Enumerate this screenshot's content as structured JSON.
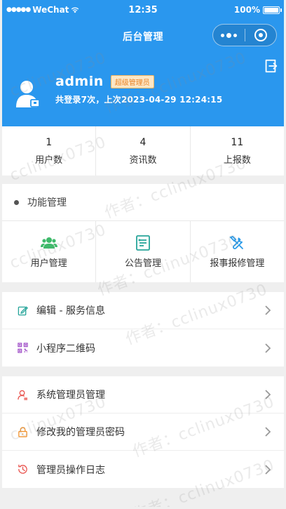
{
  "status_bar": {
    "carrier": "WeChat",
    "time": "12:35",
    "battery": "100%"
  },
  "nav": {
    "title": "后台管理"
  },
  "profile": {
    "username": "admin",
    "role": "超级管理员",
    "login_info": "共登录7次，上次2023-04-29 12:24:15"
  },
  "stats": [
    {
      "value": "1",
      "label": "用户数"
    },
    {
      "value": "4",
      "label": "资讯数"
    },
    {
      "value": "11",
      "label": "上报数"
    }
  ],
  "functions": {
    "title": "功能管理",
    "items": [
      {
        "label": "用户管理",
        "icon": "users-icon"
      },
      {
        "label": "公告管理",
        "icon": "notice-icon"
      },
      {
        "label": "报事报修管理",
        "icon": "tools-icon"
      }
    ]
  },
  "menu1": [
    {
      "label": "编辑 - 服务信息",
      "icon": "edit-icon"
    },
    {
      "label": "小程序二维码",
      "icon": "qrcode-icon"
    }
  ],
  "menu2": [
    {
      "label": "系统管理员管理",
      "icon": "admin-user-icon"
    },
    {
      "label": "修改我的管理员密码",
      "icon": "lock-icon"
    },
    {
      "label": "管理员操作日志",
      "icon": "log-icon"
    }
  ],
  "watermark": "作者：cclinux0730",
  "colors": {
    "header": "#2a97ee",
    "green": "#3fba6b",
    "teal": "#27a59a",
    "blue": "#2a9ae8",
    "purple": "#a354c9",
    "red": "#e9544f",
    "orange": "#f1922d"
  }
}
